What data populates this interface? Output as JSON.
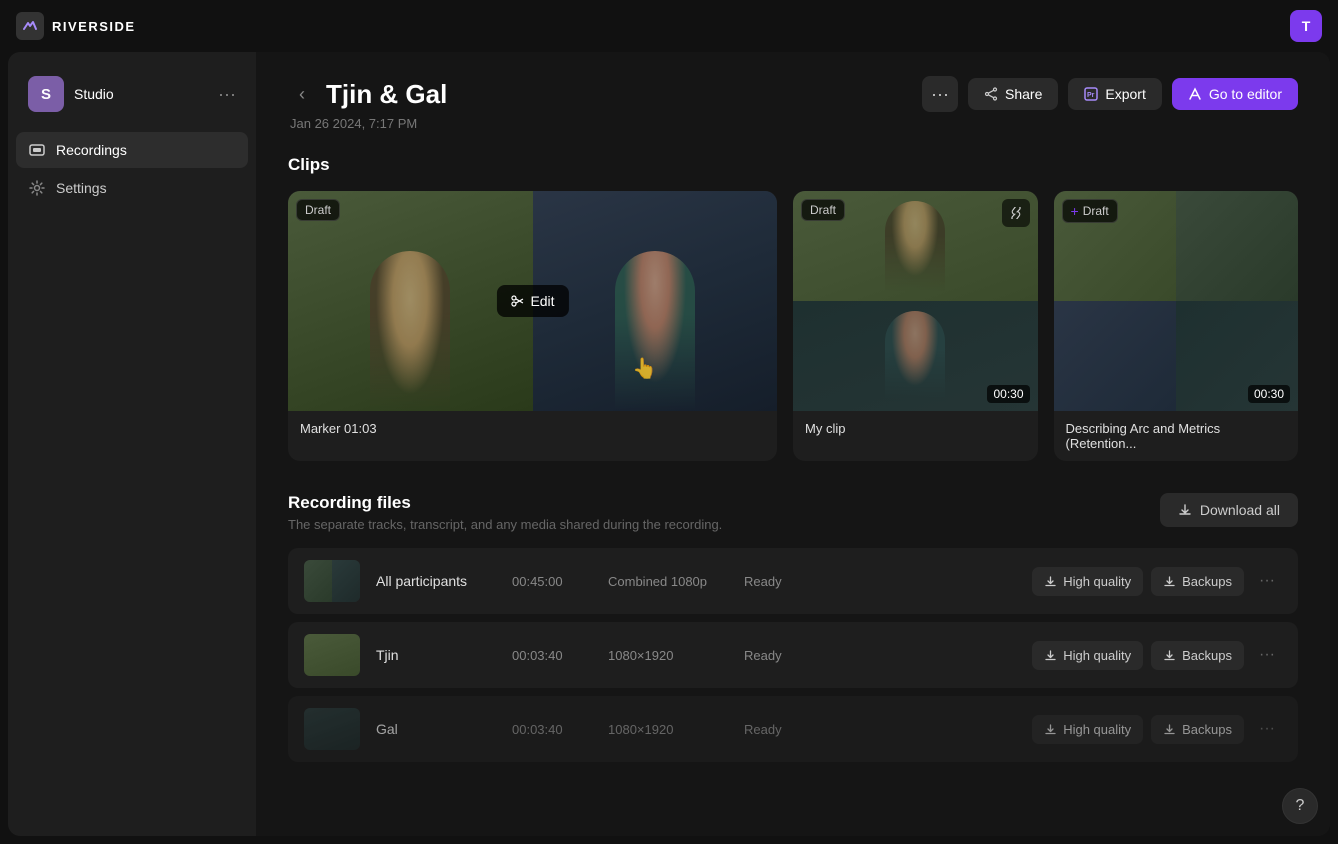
{
  "topbar": {
    "logo_text": "RIVERSIDE",
    "user_initial": "T"
  },
  "sidebar": {
    "studio_initial": "S",
    "studio_name": "Studio",
    "more_label": "···",
    "nav_items": [
      {
        "id": "recordings",
        "label": "Recordings",
        "active": true
      },
      {
        "id": "settings",
        "label": "Settings",
        "active": false
      }
    ]
  },
  "session": {
    "title": "Tjin & Gal",
    "date": "Jan 26 2024, 7:17 PM",
    "more_label": "···"
  },
  "actions": {
    "share_label": "Share",
    "export_label": "Export",
    "editor_label": "Go to editor"
  },
  "clips": {
    "section_title": "Clips",
    "items": [
      {
        "id": "clip-1",
        "label": "Marker 01:03",
        "badge": "Draft",
        "badge_plus": false,
        "duration": null,
        "large": true
      },
      {
        "id": "clip-2",
        "label": "My clip",
        "badge": "Draft",
        "badge_plus": false,
        "duration": "00:30",
        "large": false
      },
      {
        "id": "clip-3",
        "label": "Describing Arc and Metrics (Retention...",
        "badge": "Draft",
        "badge_plus": true,
        "duration": "00:30",
        "large": false
      }
    ]
  },
  "recording_files": {
    "section_title": "Recording files",
    "description": "The separate tracks, transcript, and any media shared during the recording.",
    "download_all_label": "Download all",
    "rows": [
      {
        "id": "all-participants",
        "name": "All participants",
        "duration": "00:45:00",
        "quality_label": "Combined 1080p",
        "status": "Ready",
        "hq_label": "High quality",
        "backups_label": "Backups",
        "type": "combined"
      },
      {
        "id": "tjin",
        "name": "Tjin",
        "duration": "00:03:40",
        "quality_label": "1080×1920",
        "status": "Ready",
        "hq_label": "High quality",
        "backups_label": "Backups",
        "type": "solo"
      },
      {
        "id": "gal",
        "name": "Gal",
        "duration": "00:03:40",
        "quality_label": "1080×1920",
        "status": "Ready",
        "hq_label": "High quality",
        "backups_label": "Backups",
        "type": "solo"
      }
    ]
  },
  "help": {
    "icon": "?"
  }
}
